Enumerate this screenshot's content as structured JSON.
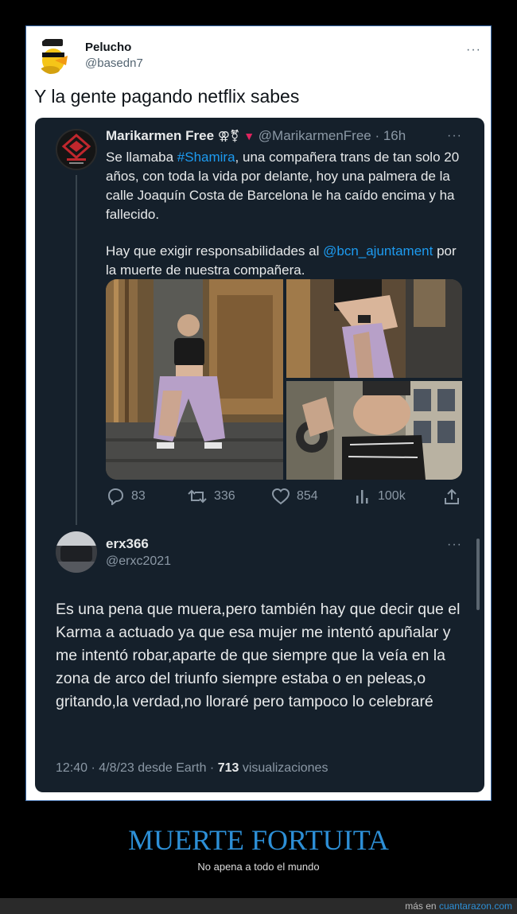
{
  "outer_tweet": {
    "name": "Pelucho",
    "handle": "@basedn7",
    "more": "···",
    "text": "Y la gente pagando netflix sabes"
  },
  "quoted_tweet": {
    "name": "Marikarmen Free",
    "symbols": "⚢⚧",
    "handle": "@MarikarmenFree",
    "time": "· 16h",
    "more": "···",
    "p1_a": "Se llamaba ",
    "p1_link": "#Shamira",
    "p1_b": ", una compañera trans de tan solo 20 años, con toda la vida por delante, hoy una palmera de la calle Joaquín Costa de Barcelona le ha caído encima y ha fallecido.",
    "p2_a": "Hay que exigir responsabilidades al ",
    "p2_link": "@bcn_ajuntament",
    "p2_b": " por la muerte de nuestra compañera.",
    "actions": {
      "replies": "83",
      "retweets": "336",
      "likes": "854",
      "views": "100k"
    }
  },
  "reply_tweet": {
    "name": "erx366",
    "handle": "@erxc2021",
    "more": "···",
    "text": "Es una pena que muera,pero también hay que decir que el Karma a actuado ya que esa mujer me intentó apuñalar y me intentó robar,aparte de que siempre que la veía en la zona de arco del triunfo siempre estaba o en peleas,o gritando,la verdad,no lloraré pero tampoco lo celebraré",
    "meta_prefix": "12:40 · 4/8/23 desde Earth · ",
    "views_count": "713",
    "views_label": " visualizaciones"
  },
  "footer": {
    "title": "MUERTE FORTUITA",
    "subtitle": "No apena a todo el mundo",
    "more_prefix": "más en ",
    "site": "cuantarazon.com"
  },
  "colors": {
    "accent_link": "#1d9bf0",
    "embed_bg": "#15202b",
    "footer_title": "#2d8fd6"
  },
  "icons": [
    "reply-icon",
    "retweet-icon",
    "like-icon",
    "views-icon",
    "share-icon"
  ]
}
